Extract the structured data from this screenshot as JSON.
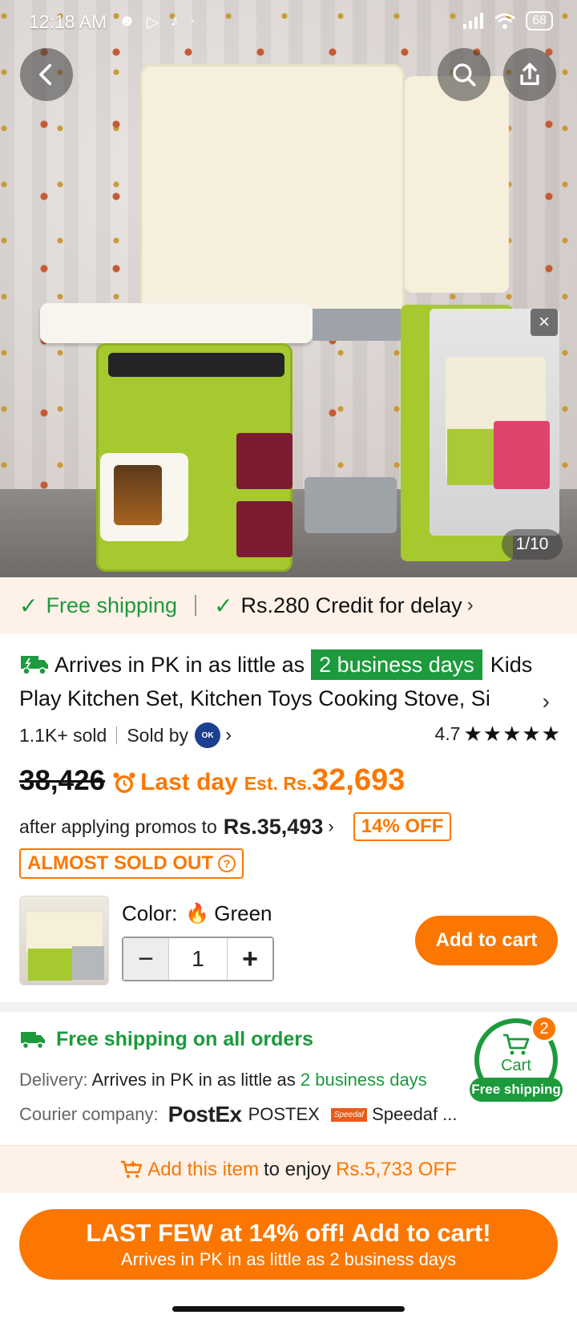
{
  "status_bar": {
    "time": "12:18 AM",
    "battery": "68"
  },
  "gallery": {
    "counter": "1/10",
    "close_symbol": "×"
  },
  "shipping_strip": {
    "free_shipping": "Free shipping",
    "credit": "Rs.280 Credit for delay"
  },
  "product": {
    "arrival_prefix": "Arrives in PK in as little as",
    "arrival_days": "2 business days",
    "title_start": "Kids",
    "title_rest": "Play Kitchen Set, Kitchen Toys Cooking Stove, Si",
    "sold": "1.1K+ sold",
    "sold_by": "Sold by",
    "rating": "4.7",
    "rating_value": 4.7,
    "stars": "★★★★★"
  },
  "price": {
    "old": "38,426",
    "last_day": "Last day",
    "est": "Est. Rs.",
    "new": "32,693",
    "promo_text": "after applying promos to",
    "promo_price": "Rs.35,493",
    "off": "14% OFF",
    "stock": "ALMOST SOLD OUT",
    "help": "?"
  },
  "variant": {
    "color_label": "Color:",
    "color_value": "Green",
    "quantity": "1",
    "minus": "−",
    "plus": "+",
    "add_to_cart": "Add to cart"
  },
  "shipping_info": {
    "free_all": "Free shipping on all orders",
    "delivery_label": "Delivery:",
    "delivery_text": "Arrives in PK in as little as",
    "delivery_days": "2 business days",
    "courier_label": "Courier company:",
    "courier_logo": "PostEx",
    "courier_1": "POSTEX",
    "courier_2_logo": "Speedaf",
    "courier_2": "Speedaf ..."
  },
  "cart": {
    "label": "Cart",
    "count": "2",
    "free": "Free shipping"
  },
  "addon": {
    "lead": "Add this item",
    "middle": "to enjoy",
    "discount": "Rs.5,733 OFF"
  },
  "cta": {
    "main": "LAST FEW at 14% off! Add to cart!",
    "sub": "Arrives in PK in as little as 2 business days"
  },
  "colors": {
    "accent": "#fb7701",
    "success": "#1c9a3c"
  }
}
